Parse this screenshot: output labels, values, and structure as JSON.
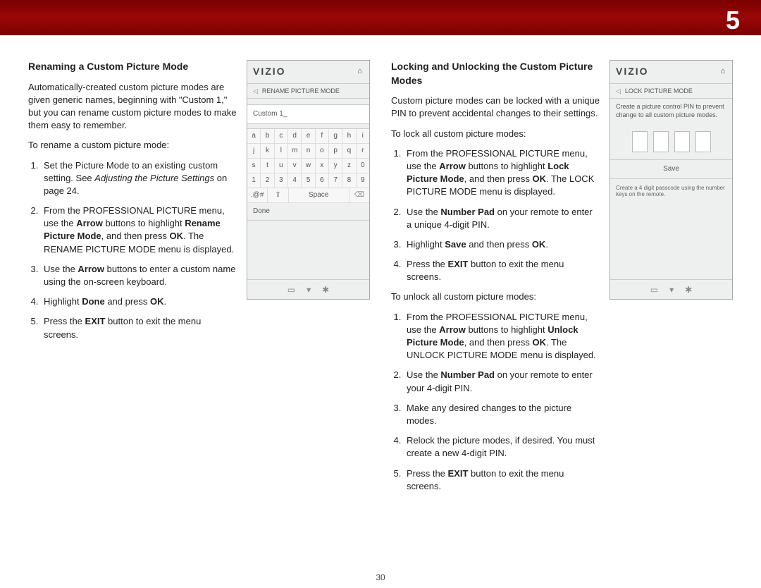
{
  "chapter_num": "5",
  "page_number": "30",
  "left": {
    "heading": "Renaming a Custom Picture Mode",
    "intro": "Automatically-created custom picture modes are given generic names, beginning with \"Custom 1,\" but you can rename custom picture modes to make them easy to remember.",
    "lead": "To rename a custom picture mode:",
    "steps": [
      "Set the Picture Mode to an existing custom setting. See <em>Adjusting the Picture Settings</em> on page 24.",
      "From the PROFESSIONAL PICTURE menu, use the <b>Arrow</b> buttons to highlight <b>Rename Picture Mode</b>, and then press <b>OK</b>. The RENAME PICTURE MODE menu is displayed.",
      "Use the <b>Arrow</b> buttons to enter a custom name using the on-screen keyboard.",
      "Highlight <b>Done</b> and press <b>OK</b>.",
      "Press the <b>EXIT</b> button to exit the menu screens."
    ],
    "device": {
      "brand": "VIZIO",
      "title": "RENAME PICTURE MODE",
      "input_value": "Custom 1_",
      "rows": [
        [
          "a",
          "b",
          "c",
          "d",
          "e",
          "f",
          "g",
          "h",
          "i"
        ],
        [
          "j",
          "k",
          "l",
          "m",
          "n",
          "o",
          "p",
          "q",
          "r"
        ],
        [
          "s",
          "t",
          "u",
          "v",
          "w",
          "x",
          "y",
          "z",
          "0"
        ],
        [
          "1",
          "2",
          "3",
          "4",
          "5",
          "6",
          "7",
          "8",
          "9"
        ]
      ],
      "sym": ".@#",
      "shift": "⇧",
      "space": "Space",
      "done": "Done"
    }
  },
  "right": {
    "heading": "Locking and Unlocking the Custom Picture Modes",
    "intro": "Custom picture modes can be locked with a unique PIN to prevent accidental changes to their settings.",
    "lead_lock": "To lock all custom picture modes:",
    "steps_lock": [
      "From the PROFESSIONAL PICTURE menu, use the <b>Arrow</b> buttons to highlight <b>Lock Picture Mode</b>, and then press <b>OK</b>. The LOCK PICTURE MODE menu is displayed.",
      "Use the <b>Number Pad</b> on your remote to enter a unique 4-digit PIN.",
      "Highlight <b>Save</b> and then press <b>OK</b>.",
      "Press the <b>EXIT</b> button to exit the menu screens."
    ],
    "lead_unlock": "To unlock all custom picture modes:",
    "steps_unlock": [
      "From the PROFESSIONAL PICTURE menu, use the <b>Arrow</b> buttons to highlight <b>Unlock Picture Mode</b>, and then press <b>OK</b>. The UNLOCK PICTURE MODE menu is displayed.",
      "Use the <b>Number Pad</b> on your remote to enter your 4-digit PIN.",
      "Make any desired changes to the picture modes.",
      "Relock the picture modes, if desired. You must create a new 4-digit PIN.",
      "Press the <b>EXIT</b> button to exit the menu screens."
    ],
    "device": {
      "brand": "VIZIO",
      "title": "LOCK PICTURE MODE",
      "msg": "Create a picture control PIN to prevent change to all custom picture modes.",
      "save": "Save",
      "hint": "Create a 4 digit passcode using the number keys on the remote."
    }
  }
}
